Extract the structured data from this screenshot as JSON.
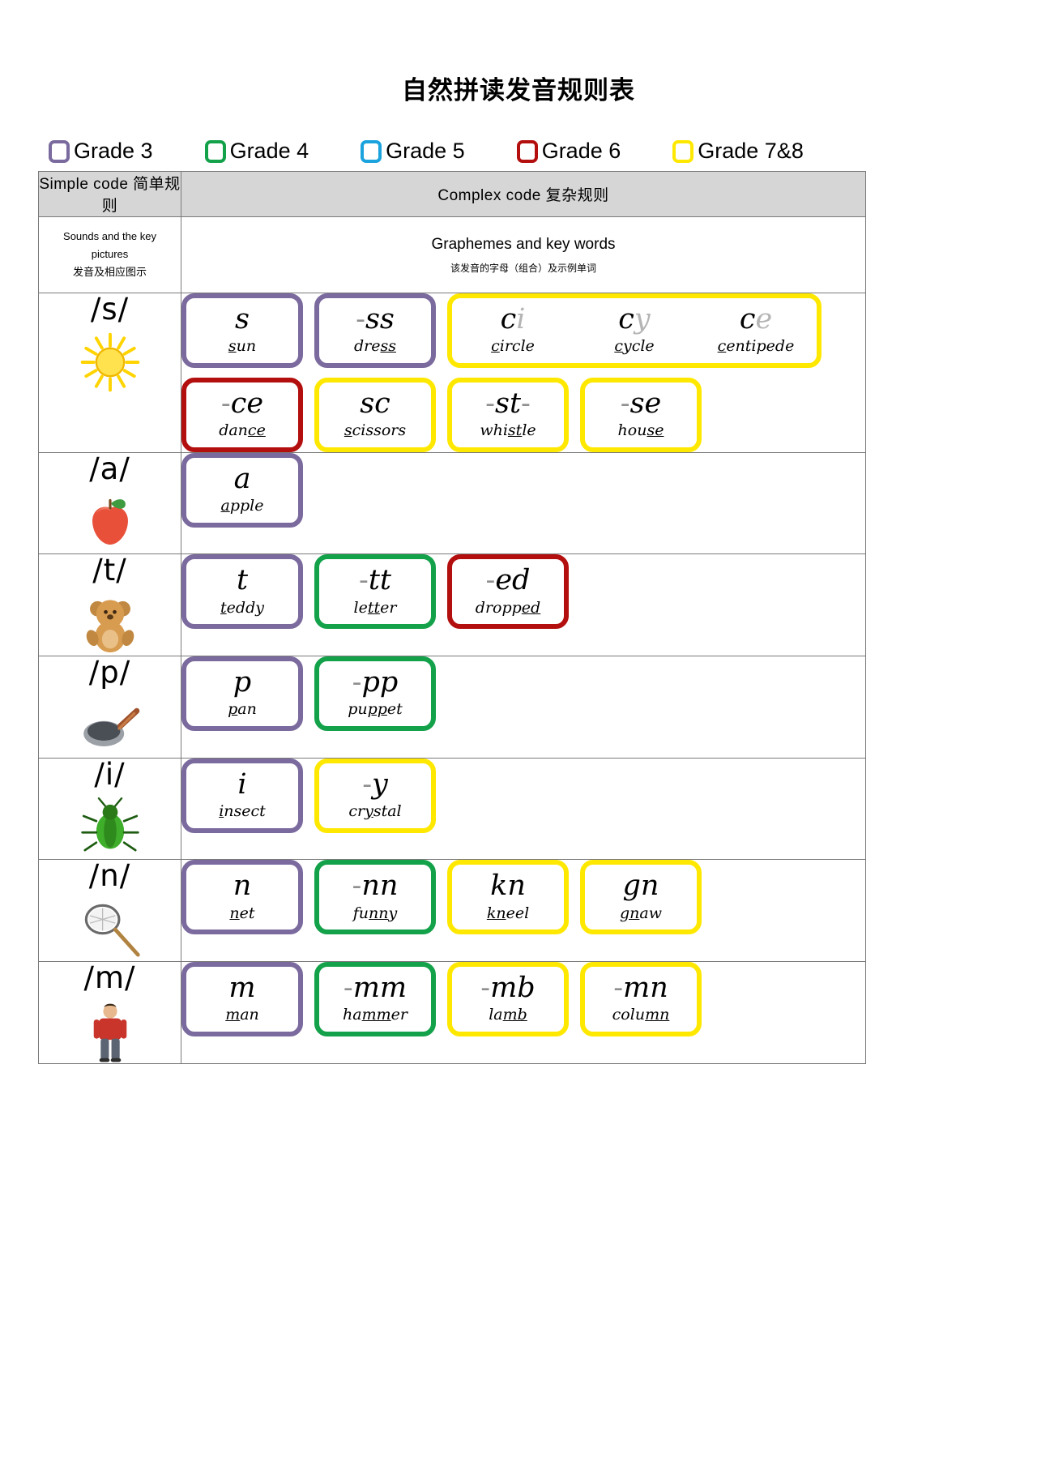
{
  "title": "自然拼读发音规则表",
  "legend": {
    "items": [
      {
        "label": "Grade 3",
        "color": "#7a6a9e"
      },
      {
        "label": "Grade 4",
        "color": "#13a14a"
      },
      {
        "label": "Grade 5",
        "color": "#1ba3dd"
      },
      {
        "label": "Grade 6",
        "color": "#b30f0f"
      },
      {
        "label": "Grade 7&8",
        "color": "#ffe800"
      }
    ]
  },
  "table": {
    "header": {
      "simple_code": "Simple code  简单规则",
      "complex_code": "Complex code  复杂规则"
    },
    "subheader": {
      "left_en": "Sounds and the key pictures",
      "left_cn": "发音及相应图示",
      "right_en": "Graphemes and key words",
      "right_cn": "该发音的字母（组合）及示例单词"
    },
    "rows": [
      {
        "phoneme": "/s/",
        "picture": "sun",
        "simple": [
          {
            "grapheme": "s",
            "dim": "",
            "keyword_pre": "",
            "keyword_u": "s",
            "keyword_post": "un",
            "grade": "Grade 3"
          }
        ],
        "lines": [
          {
            "groups": [
              {
                "grade": "Grade 3",
                "cells": [
                  {
                    "grapheme": "-ss",
                    "dim": "",
                    "keyword_pre": "dre",
                    "keyword_u": "ss",
                    "keyword_post": ""
                  }
                ]
              },
              {
                "grade": "Grade 7&8",
                "cells": [
                  {
                    "grapheme": "c",
                    "dim": "i",
                    "keyword_pre": "",
                    "keyword_u": "c",
                    "keyword_post": "ircle"
                  },
                  {
                    "grapheme": "c",
                    "dim": "y",
                    "keyword_pre": "",
                    "keyword_u": "c",
                    "keyword_post": "ycle"
                  },
                  {
                    "grapheme": "c",
                    "dim": "e",
                    "keyword_pre": "",
                    "keyword_u": "c",
                    "keyword_post": "entipede"
                  }
                ]
              }
            ]
          },
          {
            "groups": [
              {
                "grade": "Grade 6",
                "cells": [
                  {
                    "grapheme": "-ce",
                    "dim": "",
                    "keyword_pre": "dan",
                    "keyword_u": "ce",
                    "keyword_post": ""
                  }
                ]
              },
              {
                "grade": "Grade 7&8",
                "cells": [
                  {
                    "grapheme": "sc",
                    "dim": "",
                    "keyword_pre": "",
                    "keyword_u": "s",
                    "keyword_post": "cissors"
                  }
                ]
              },
              {
                "grade": "Grade 7&8",
                "cells": [
                  {
                    "grapheme": "-st-",
                    "dim": "",
                    "keyword_pre": "whi",
                    "keyword_u": "st",
                    "keyword_post": "le"
                  }
                ]
              },
              {
                "grade": "Grade 7&8",
                "cells": [
                  {
                    "grapheme": "-se",
                    "dim": "",
                    "keyword_pre": "hou",
                    "keyword_u": "se",
                    "keyword_post": ""
                  }
                ]
              }
            ]
          }
        ]
      },
      {
        "phoneme": "/a/",
        "picture": "apple",
        "lines": [
          {
            "groups": [
              {
                "grade": "Grade 3",
                "cells": [
                  {
                    "grapheme": "a",
                    "dim": "",
                    "keyword_pre": "",
                    "keyword_u": "a",
                    "keyword_post": "pple"
                  }
                ]
              }
            ]
          }
        ]
      },
      {
        "phoneme": "/t/",
        "picture": "teddy",
        "lines": [
          {
            "groups": [
              {
                "grade": "Grade 3",
                "cells": [
                  {
                    "grapheme": "t",
                    "dim": "",
                    "keyword_pre": "",
                    "keyword_u": "t",
                    "keyword_post": "eddy"
                  }
                ]
              },
              {
                "grade": "Grade 4",
                "cells": [
                  {
                    "grapheme": "-tt",
                    "dim": "",
                    "keyword_pre": "le",
                    "keyword_u": "tt",
                    "keyword_post": "er"
                  }
                ]
              },
              {
                "grade": "Grade 6",
                "cells": [
                  {
                    "grapheme": "-ed",
                    "dim": "",
                    "keyword_pre": "dropp",
                    "keyword_u": "ed",
                    "keyword_post": ""
                  }
                ]
              }
            ]
          }
        ]
      },
      {
        "phoneme": "/p/",
        "picture": "pan",
        "lines": [
          {
            "groups": [
              {
                "grade": "Grade 3",
                "cells": [
                  {
                    "grapheme": "p",
                    "dim": "",
                    "keyword_pre": "",
                    "keyword_u": "p",
                    "keyword_post": "an"
                  }
                ]
              },
              {
                "grade": "Grade 4",
                "cells": [
                  {
                    "grapheme": "-pp",
                    "dim": "",
                    "keyword_pre": "pu",
                    "keyword_u": "pp",
                    "keyword_post": "et"
                  }
                ]
              }
            ]
          }
        ]
      },
      {
        "phoneme": "/i/",
        "picture": "insect",
        "lines": [
          {
            "groups": [
              {
                "grade": "Grade 3",
                "cells": [
                  {
                    "grapheme": "i",
                    "dim": "",
                    "keyword_pre": "",
                    "keyword_u": "i",
                    "keyword_post": "nsect"
                  }
                ]
              },
              {
                "grade": "Grade 7&8",
                "cells": [
                  {
                    "grapheme": "-y",
                    "dim": "",
                    "keyword_pre": "cr",
                    "keyword_u": "y",
                    "keyword_post": "stal"
                  }
                ]
              }
            ]
          }
        ]
      },
      {
        "phoneme": "/n/",
        "picture": "net",
        "lines": [
          {
            "groups": [
              {
                "grade": "Grade 3",
                "cells": [
                  {
                    "grapheme": "n",
                    "dim": "",
                    "keyword_pre": "",
                    "keyword_u": "n",
                    "keyword_post": "et"
                  }
                ]
              },
              {
                "grade": "Grade 4",
                "cells": [
                  {
                    "grapheme": "-nn",
                    "dim": "",
                    "keyword_pre": "fu",
                    "keyword_u": "nn",
                    "keyword_post": "y"
                  }
                ]
              },
              {
                "grade": "Grade 7&8",
                "cells": [
                  {
                    "grapheme": "kn",
                    "dim": "",
                    "keyword_pre": "",
                    "keyword_u": "kn",
                    "keyword_post": "eel"
                  }
                ]
              },
              {
                "grade": "Grade 7&8",
                "cells": [
                  {
                    "grapheme": "gn",
                    "dim": "",
                    "keyword_pre": "",
                    "keyword_u": "gn",
                    "keyword_post": "aw"
                  }
                ]
              }
            ]
          }
        ]
      },
      {
        "phoneme": "/m/",
        "picture": "man",
        "lines": [
          {
            "groups": [
              {
                "grade": "Grade 3",
                "cells": [
                  {
                    "grapheme": "m",
                    "dim": "",
                    "keyword_pre": "",
                    "keyword_u": "m",
                    "keyword_post": "an"
                  }
                ]
              },
              {
                "grade": "Grade 4",
                "cells": [
                  {
                    "grapheme": "-mm",
                    "dim": "",
                    "keyword_pre": "ha",
                    "keyword_u": "mm",
                    "keyword_post": "er"
                  }
                ]
              },
              {
                "grade": "Grade 7&8",
                "cells": [
                  {
                    "grapheme": "-mb",
                    "dim": "",
                    "keyword_pre": "la",
                    "keyword_u": "mb",
                    "keyword_post": ""
                  }
                ]
              },
              {
                "grade": "Grade 7&8",
                "cells": [
                  {
                    "grapheme": "-mn",
                    "dim": "",
                    "keyword_pre": "colu",
                    "keyword_u": "mn",
                    "keyword_post": ""
                  }
                ]
              }
            ]
          }
        ]
      }
    ]
  }
}
